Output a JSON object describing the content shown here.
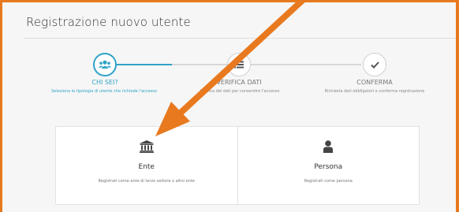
{
  "page": {
    "title": "Registrazione nuovo utente"
  },
  "wizard": {
    "steps": [
      {
        "label": "CHI SEI?",
        "description": "Seleziona la tipologia di utente che richiede l'accesso",
        "status": "active",
        "icon": "users-icon"
      },
      {
        "label": "VERIFICA DATI",
        "description": "Verifica dei dati per consentire l'accesso",
        "status": "inactive",
        "icon": "list-icon"
      },
      {
        "label": "CONFERMA",
        "description": "Richiesta dati obbligatori e conferma registrazione",
        "status": "inactive",
        "icon": "check-icon"
      }
    ]
  },
  "options": [
    {
      "title": "Ente",
      "description": "Registrati come ente di terzo settore o altro ente",
      "icon": "institution-icon"
    },
    {
      "title": "Persona",
      "description": "Registrati come persona",
      "icon": "person-icon"
    }
  ],
  "colors": {
    "accent": "#2fa3c7",
    "annotation": "#e8791f",
    "panel_bg": "#f6f6f6"
  }
}
